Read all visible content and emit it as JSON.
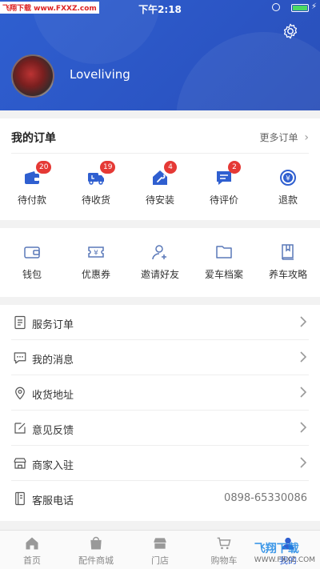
{
  "status_bar": {
    "watermark": "飞翔下载 www.FXXZ.com",
    "time": "下午2:18"
  },
  "profile": {
    "username": "Loveliving"
  },
  "orders": {
    "title": "我的订单",
    "more": "更多订单",
    "items": [
      {
        "label": "待付款",
        "badge": "20",
        "icon": "wallet-icon"
      },
      {
        "label": "待收货",
        "badge": "19",
        "icon": "truck-icon"
      },
      {
        "label": "待安装",
        "badge": "4",
        "icon": "wrench-icon"
      },
      {
        "label": "待评价",
        "badge": "2",
        "icon": "comment-icon"
      },
      {
        "label": "退款",
        "badge": "",
        "icon": "refund-icon"
      }
    ]
  },
  "tools": {
    "items": [
      {
        "label": "钱包",
        "icon": "wallet-outline-icon"
      },
      {
        "label": "优惠券",
        "icon": "coupon-icon"
      },
      {
        "label": "邀请好友",
        "icon": "add-user-icon"
      },
      {
        "label": "爱车档案",
        "icon": "folder-icon"
      },
      {
        "label": "养车攻略",
        "icon": "book-icon"
      }
    ]
  },
  "menu": {
    "items": [
      {
        "label": "服务订单",
        "icon": "document-icon"
      },
      {
        "label": "我的消息",
        "icon": "message-icon"
      },
      {
        "label": "收货地址",
        "icon": "location-icon"
      },
      {
        "label": "意见反馈",
        "icon": "edit-icon"
      },
      {
        "label": "商家入驻",
        "icon": "store-icon"
      },
      {
        "label": "客服电话",
        "icon": "phone-book-icon",
        "value": "0898-65330086"
      }
    ]
  },
  "tabbar": {
    "items": [
      {
        "label": "首页",
        "icon": "home-icon"
      },
      {
        "label": "配件商城",
        "icon": "shopping-bag-icon"
      },
      {
        "label": "门店",
        "icon": "shop-icon"
      },
      {
        "label": "购物车",
        "icon": "cart-icon"
      },
      {
        "label": "我的",
        "icon": "user-icon",
        "active": true
      }
    ]
  },
  "watermark_bottom": {
    "brand": "飞翔下载",
    "url": "WWW.FXXZ.COM"
  },
  "colors": {
    "primary": "#2f5fd0",
    "badge": "#e53935"
  }
}
